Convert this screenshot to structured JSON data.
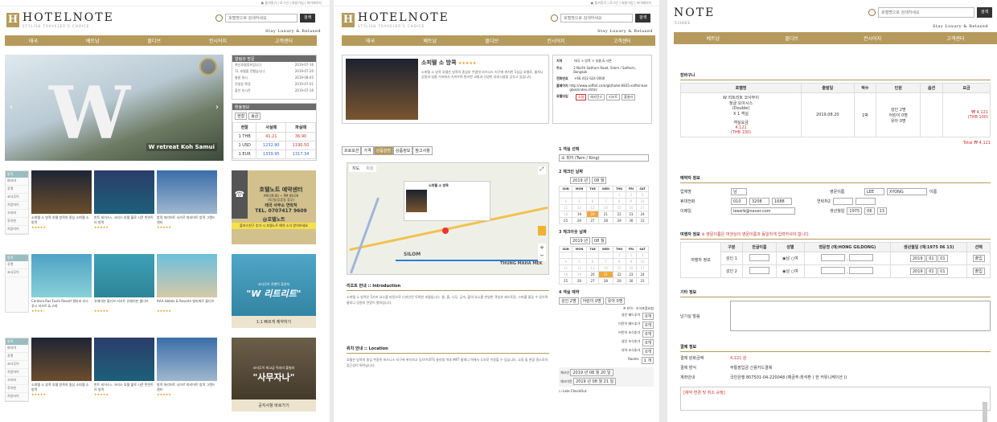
{
  "brand": {
    "name": "HOTELNOTE",
    "tagline": "STYLISH TRAVELER'S CHOICE",
    "slogan": "Stay Luxury & Relaxed"
  },
  "topbar_text": "● 즐겨찾기 | 로그인 | 회원가입 | 마이페이지",
  "search": {
    "placeholder": "호텔명으로 검색하세요",
    "button": "검색"
  },
  "nav": [
    "태국",
    "베트남",
    "몰디브",
    "컨시어지",
    "고객센터"
  ],
  "p1": {
    "hero_caption": "W retreat Koh Samui",
    "notice": {
      "title": "알림과 방문",
      "items": [
        {
          "t": "최신호텔정보입니다",
          "d": "2019-07-16"
        },
        {
          "t": "11 호텔을 전했습니다",
          "d": "2019-07-20"
        },
        {
          "t": "울릉 마시",
          "d": "2019-08-05"
        },
        {
          "t": "전설등 확정",
          "d": "2019-07-01"
        },
        {
          "t": "할인 포시즌",
          "d": "2019-07-16"
        }
      ]
    },
    "rate": {
      "title": "환율정보",
      "tab1": "현찰",
      "tab2": "송금",
      "head": [
        "현찰",
        "사실때",
        "파실때"
      ],
      "rows": [
        {
          "c": "1 THB",
          "b": "41.21",
          "s": "36.90"
        },
        {
          "c": "1 USD",
          "b": "1232.90",
          "s": "1190.50"
        },
        {
          "c": "1 EUR",
          "b": "1339.95",
          "s": "1317.34"
        }
      ]
    },
    "cats": [
      "방콕",
      "파타야",
      "푸켓",
      "코사무이",
      "치앙마이",
      "끄라비",
      "후아힌",
      "치앙라이"
    ],
    "cats_short": [
      "방콕",
      "푸켓",
      "코사무이"
    ],
    "cards1": [
      {
        "t": "소피텔 소 방콕 호텔 방콕의 중심 소피텔 소 방콕",
        "s": "★★★★★"
      },
      {
        "t": "반트 비거스느 크리스 호텔 블로 시콘 반얀트리 방콕",
        "s": "★★★★★"
      },
      {
        "t": "방콕 마리어트 사가르 마리어트 방콕 그랜드 센터",
        "s": "★★★★★"
      }
    ],
    "cards2": [
      {
        "t": "Centara Ras Fushi Resort 센타라 라스 푸시 리조트 & 스파",
        "s": "★★★★☆"
      },
      {
        "t": "유헤이븐 몰디브 리조트 유헤이븐 몰디브",
        "s": "★★★★★"
      },
      {
        "t": "AAA Hotels & Resorts 빌리파르 몰디브",
        "s": "★★★★★"
      }
    ],
    "cards3": [
      {
        "t": "소피텔 소 방콕 호텔 방콕의 중심 소피텔 소 방콕",
        "s": "★★★★★"
      },
      {
        "t": "반트 비거스느 크리스 호텔 블로 시콘 반얀트리 방콕",
        "s": "★★★★★"
      },
      {
        "t": "방콕 마리어트 사가르 마리어트 방콕 그랜드 센터",
        "s": "★★★★★"
      }
    ],
    "promo1": {
      "title": "호텔노트 예약센터",
      "l1": "AM 09:00 ~ PM 06:00",
      "l2": "(토/일/공휴일 휴무)",
      "l3": "태국 사무소 연락처",
      "l4": "TEL. 0707417 9609",
      "kakao": "@호텔노트",
      "foot": "플러스친구 추가 시 호텔노트 예약 소식 받아보세요"
    },
    "promo2": {
      "top": "코사무이 로맨틱 휴양지",
      "big": "\"W 리트리트\"",
      "foot": "1:1 빠르게 예약하기"
    },
    "promo3": {
      "top": "코사무이 최고급 럭셔리 풀빌라",
      "big": "\"사무자나\"",
      "foot": "공지사항 바로가기"
    }
  },
  "p2": {
    "hotel_name": "소피텔 소 방콕",
    "stars": "★★★★★",
    "desc": "소피텔 소 방콕 호텔은 방콕의 중심부 쑤쿰빗 비즈니스 지구에 위치한 5성급 호텔로, 룸피니 공원과 실롬 거리에서 가까우며 편리한 교통과 다양한 부대시설을 갖추고 있습니다.",
    "info": [
      {
        "k": "지역",
        "v": "태국 > 방콕 > 실롬 & 사톤"
      },
      {
        "k": "주소",
        "v": "2 North Sathorn Road, Silom / Sathorn, Bangkok"
      },
      {
        "k": "전화번호",
        "v": "+66 (0)2 624 0000"
      },
      {
        "k": "홈페이지",
        "v": "http://www.sofitel.com/gb/hotel-6835-sofitel-bangkok/index.shtml"
      },
      {
        "k": "호텔타입",
        "v": ""
      }
    ],
    "type_tags": [
      "호텔",
      "레지던스",
      "리조트",
      "풀빌라"
    ],
    "tabs": [
      "프로모션",
      "가격",
      "상품설명",
      "상품정보",
      "참고사항"
    ],
    "map": {
      "t1": "지도",
      "t2": "위성",
      "popup_title": "소피텔 소 방콕",
      "area": "SILOM",
      "area2": "THUNG MAHA MEK"
    },
    "intro_title": "리조트 안내 :: Introduction",
    "intro_text": "소피텔 소 방콕은 5가지 요소를 바탕으로 디자인된 독특한 호텔입니다. 물, 흙, 나무, 금속, 불의 요소를 반영한 객실과 레스토랑, 스파를 즐길 수 있으며 룸피니 공원의 전망이 펼쳐집니다.",
    "loc_title": "위치 안내 :: Location",
    "loc_text": "호텔은 방콕의 중심 쑤쿰빗 비즈니스 지구에 위치하고 있으며 BTS 살라댕 역과 MRT 룸피니 역에서 도보로 이동할 수 있습니다. 쇼핑 및 관광 명소로의 접근성이 뛰어납니다.",
    "step1": "1 객실 선택",
    "room_select": "소 피어 (Twin / King)",
    "step2": "2 체크인 날짜",
    "step3": "3 체크아웃 날짜",
    "year": "2019 년",
    "month": "08 월",
    "dow": [
      "SUN",
      "MON",
      "TUE",
      "WED",
      "THU",
      "FRI",
      "SAT"
    ],
    "step4": "4 객실 예약",
    "opts": [
      "성인 2명",
      "어린이 0명",
      "유아 0명"
    ],
    "breakfast": "※ 유아 - 조식포함요청",
    "pricing": [
      {
        "k": "성인 배드추가",
        "v": "0개"
      },
      {
        "k": "어린이 배드추가",
        "v": "0개"
      },
      {
        "k": "어린이 조식추가",
        "v": "0개"
      },
      {
        "k": "성인 조식추가",
        "v": "0개"
      },
      {
        "k": "유아 조식추가",
        "v": "0개"
      },
      {
        "k": "Rooms",
        "v": "1 개"
      }
    ],
    "checkin_lbl": "체크인",
    "checkout_lbl": "체크아웃",
    "ci": "2019 년 08 월 20 일",
    "co": "2019 년 08 월 21 일",
    "late": "Late CheckOut"
  },
  "p3": {
    "cart_title": "장바구니",
    "cart_head": [
      "호텔명",
      "출발일",
      "박수",
      "인원",
      "옵션",
      "요금"
    ],
    "cart_row": {
      "hotel": "W 리트리트 코사무이",
      "room": "정글 오아시스",
      "type": "(Double)",
      "qty": "X 1 객실",
      "sub": "객실요금",
      "sub_price": "4,121",
      "sub_thb": "(THB 100)",
      "date": "2019.08.20",
      "nights": "1박",
      "people": "성인 2명\n어린이 0명\n유아 0명",
      "price": "₩ 4,121",
      "price_thb": "(THB 100)"
    },
    "total": "Total ₩ 4,121",
    "booker_title": "예약자 정보",
    "booker": {
      "name_lbl": "업체명",
      "sel": "남",
      "eng_lbl": "영문이름",
      "last": "LEE",
      "first": "XYONG",
      "eng_suffix": "이름",
      "phone_lbl": "휴대전화",
      "p1": "010",
      "p2": "3208",
      "p3": "1688",
      "contact2": "연락처2",
      "email_lbl": "이메일",
      "email": "leesrb@naver.com",
      "birth_lbl": "생년월일",
      "by": "1975",
      "bm": "06",
      "bd": "13"
    },
    "guest_title": "여행자 정보",
    "guest_note": "※ 영문이름은 여권상의 영문이름과 동일하게 입력하셔야 합니다.",
    "guest_head": [
      "구분",
      "한글이름",
      "성별",
      "영문명 (예:HONG GILDONG)",
      "생년월일 (예:1975 06 13)",
      "선택"
    ],
    "guests": [
      {
        "k": "성인 1",
        "y": "2019",
        "m": "01",
        "d": "01",
        "btn": "출입"
      },
      {
        "k": "성인 2",
        "y": "2019",
        "m": "01",
        "d": "01",
        "btn": "출입"
      }
    ],
    "guest_row_lbl": "여행자 정보",
    "etc_title": "기타 정보",
    "etc_lbl": "남기실 말씀",
    "pay_title": "결제 정보",
    "pay": [
      {
        "k": "결제 원화금액",
        "v": "4,121 원"
      },
      {
        "k": "결제 방식",
        "v": "무통장입금   신용카드결제"
      },
      {
        "k": "계좌안내",
        "v": "국민은행 807501-04-220048 (예금주:최석환 ( 한 커뮤니케이션 ))"
      }
    ],
    "notice_red": "[예약 변경 및 취소 규정]"
  },
  "colors": {
    "gold": "#b59a5c",
    "dark": "#333333",
    "red": "#cc2222"
  }
}
